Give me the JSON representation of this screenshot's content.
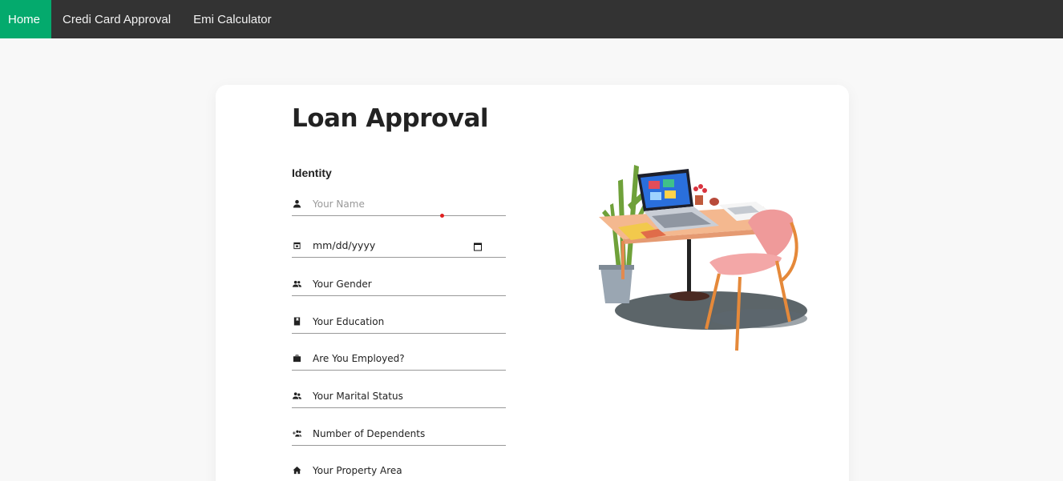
{
  "nav": {
    "items": [
      {
        "label": "Home",
        "active": true
      },
      {
        "label": "Credi Card Approval",
        "active": false
      },
      {
        "label": "Emi Calculator",
        "active": false
      }
    ],
    "active_color": "#04aa6d",
    "background_color": "#333333"
  },
  "form": {
    "title": "Loan Approval",
    "section_label": "Identity",
    "name_placeholder": "Your Name",
    "dob_value": "mm/dd/yyyy",
    "gender_label": "Your Gender",
    "education_label": "Your Education",
    "employed_label": "Are You Employed?",
    "marital_label": "Your Marital Status",
    "dependents_label": "Number of Dependents",
    "property_label": "Your Property Area"
  },
  "icons": {
    "name": "person-icon",
    "dob": "calendar-icon",
    "gender": "people-icon",
    "education": "book-icon",
    "employed": "briefcase-icon",
    "marital": "couple-icon",
    "dependents": "group-add-icon",
    "property": "home-icon"
  }
}
